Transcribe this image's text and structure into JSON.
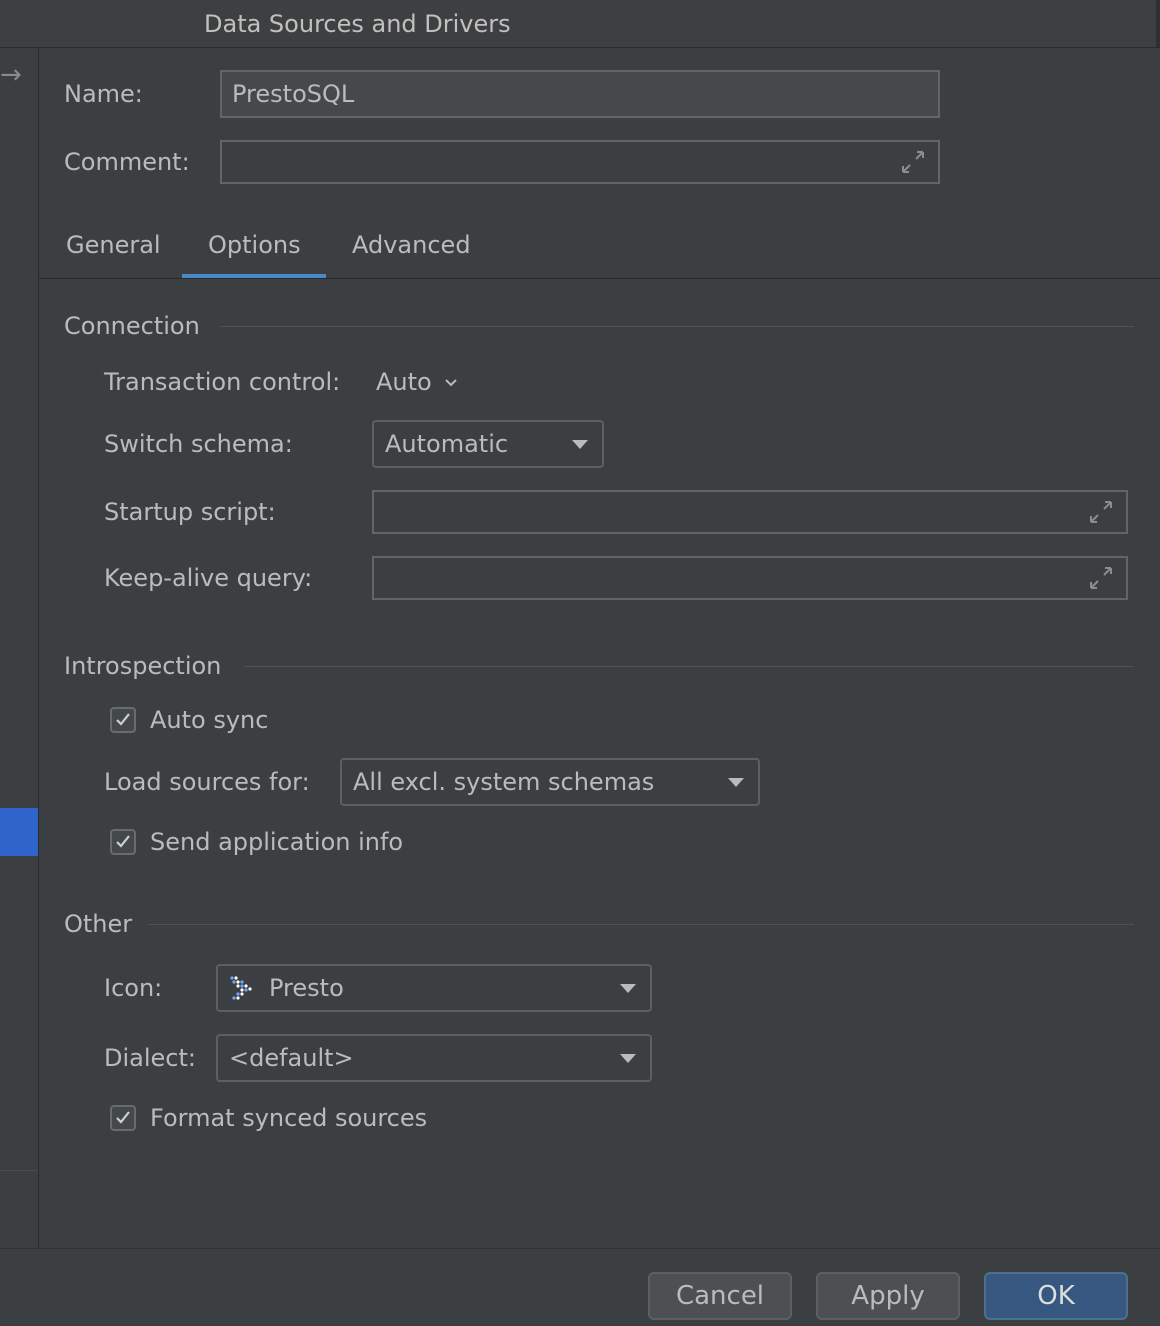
{
  "window": {
    "title": "Data Sources and Drivers"
  },
  "form": {
    "name_label": "Name:",
    "name_value": "PrestoSQL",
    "comment_label": "Comment:",
    "comment_value": ""
  },
  "tabs": [
    {
      "label": "General",
      "active": false
    },
    {
      "label": "Options",
      "active": true
    },
    {
      "label": "Advanced",
      "active": false
    }
  ],
  "connection": {
    "heading": "Connection",
    "transaction_label": "Transaction control:",
    "transaction_value": "Auto",
    "switch_schema_label": "Switch schema:",
    "switch_schema_value": "Automatic",
    "startup_label": "Startup script:",
    "startup_value": "",
    "keepalive_label": "Keep-alive query:",
    "keepalive_value": ""
  },
  "introspection": {
    "heading": "Introspection",
    "auto_sync_label": "Auto sync",
    "auto_sync_checked": true,
    "load_sources_label": "Load sources for:",
    "load_sources_value": "All excl. system schemas",
    "send_info_label": "Send application info",
    "send_info_checked": true
  },
  "other": {
    "heading": "Other",
    "icon_label": "Icon:",
    "icon_value": "Presto",
    "icon_name": "presto-icon",
    "dialect_label": "Dialect:",
    "dialect_value": "<default>",
    "format_label": "Format synced sources",
    "format_checked": true
  },
  "buttons": {
    "cancel": "Cancel",
    "apply": "Apply",
    "ok": "OK"
  },
  "colors": {
    "accent": "#4a88c7",
    "selection": "#2f65ca",
    "primary_button": "#365880"
  }
}
